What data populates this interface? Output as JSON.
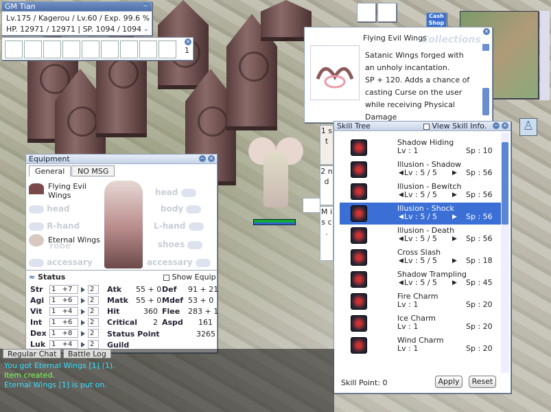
{
  "basic": {
    "name": "GM Tian",
    "line1": "Lv.175 / Kagerou / Lv.60 / Exp. 99.6 %",
    "line2": "HP. 12971 / 12971 | SP. 1094 / 1094"
  },
  "hotkey": {
    "page": "1"
  },
  "shop": {
    "label1": "Cash",
    "label2": "Shop"
  },
  "item": {
    "title": "Flying Evil Wings",
    "desc": [
      "Satanic Wings forged with",
      "an unholy incantation.",
      "SP + 120. Adds a chance of",
      "casting Curse on the user",
      "while receiving Physical",
      "Damage"
    ],
    "bg_text": "Collections"
  },
  "equip": {
    "title": "Equipment",
    "tab1": "General",
    "tab2": "NO MSG",
    "slot_top_left_name": "Flying Evil Wings",
    "slot_mid_left_name": "Eternal Wings",
    "left_slots": [
      "head",
      "R-hand",
      "robe",
      "accessary"
    ],
    "right_slots": [
      "head",
      "body",
      "L-hand",
      "shoes",
      "accessary"
    ],
    "status_label": "Status",
    "show_equip": "Show Equip"
  },
  "stats": [
    {
      "name": "Str",
      "base": "1",
      "bonus": "+7",
      "cost": "2"
    },
    {
      "name": "Agi",
      "base": "1",
      "bonus": "+6",
      "cost": "2"
    },
    {
      "name": "Vit",
      "base": "1",
      "bonus": "+4",
      "cost": "2"
    },
    {
      "name": "Int",
      "base": "1",
      "bonus": "+6",
      "cost": "2"
    },
    {
      "name": "Dex",
      "base": "1",
      "bonus": "+8",
      "cost": "2"
    },
    {
      "name": "Luk",
      "base": "1",
      "bonus": "+4",
      "cost": "2"
    }
  ],
  "combat": [
    {
      "k": "Atk",
      "v": "55 + 0",
      "k2": "Def",
      "v2": "91 + 21"
    },
    {
      "k": "Matk",
      "v": "55 + 0",
      "k2": "Mdef",
      "v2": "53 + 0"
    },
    {
      "k": "Hit",
      "v": "360",
      "k2": "Flee",
      "v2": "283 + 1"
    },
    {
      "k": "Critical",
      "v": "2",
      "k2": "Aspd",
      "v2": "161"
    }
  ],
  "status_point": {
    "label": "Status Point",
    "value": "3265"
  },
  "guild": "Guild",
  "skilltree": {
    "title": "Skill Tree",
    "view_info": "View Skill Info.",
    "skill_point": "Skill Point: 0",
    "apply": "Apply",
    "reset": "Reset",
    "skills": [
      {
        "name": "Shadow Hiding",
        "lv": "Lv : 1",
        "sp": "Sp : 10",
        "arrows": false
      },
      {
        "name": "Illusion - Shadow",
        "lv": "Lv :   5  /  5",
        "sp": "Sp : 56",
        "arrows": true
      },
      {
        "name": "Illusion - Bewitch",
        "lv": "Lv :   5  /  5",
        "sp": "Sp : 56",
        "arrows": true
      },
      {
        "name": "Illusion - Shock",
        "lv": "Lv :   5  /  5",
        "sp": "Sp : 56",
        "arrows": true
      },
      {
        "name": "Illusion - Death",
        "lv": "Lv :   5  /  5",
        "sp": "Sp : 56",
        "arrows": true
      },
      {
        "name": "Cross Slash",
        "lv": "Lv :   5  /  5",
        "sp": "Sp : 18",
        "arrows": true
      },
      {
        "name": "Shadow Trampling",
        "lv": "Lv :   5  /  5",
        "sp": "Sp : 45",
        "arrows": true
      },
      {
        "name": "Fire Charm",
        "lv": "Lv : 1",
        "sp": "Sp : 20",
        "arrows": false
      },
      {
        "name": "Ice Charm",
        "lv": "Lv : 1",
        "sp": "Sp : 20",
        "arrows": false
      },
      {
        "name": "Wind Charm",
        "lv": "Lv : 1",
        "sp": "Sp : 20",
        "arrows": false
      }
    ]
  },
  "sidetabs": [
    {
      "label": "1 s t"
    },
    {
      "label": "2 n d"
    },
    {
      "label": "M i s c ."
    }
  ],
  "chat": {
    "tab1": "Regular Chat",
    "tab2": "Battle Log",
    "lines": [
      {
        "text": "You got Eternal Wings [1] (1).",
        "color": "#35e0ff"
      },
      {
        "text": "Item created.",
        "color": "#7cff5a"
      },
      {
        "text": "Eternal Wings [1] is put on.",
        "color": "#35e0ff"
      }
    ]
  }
}
